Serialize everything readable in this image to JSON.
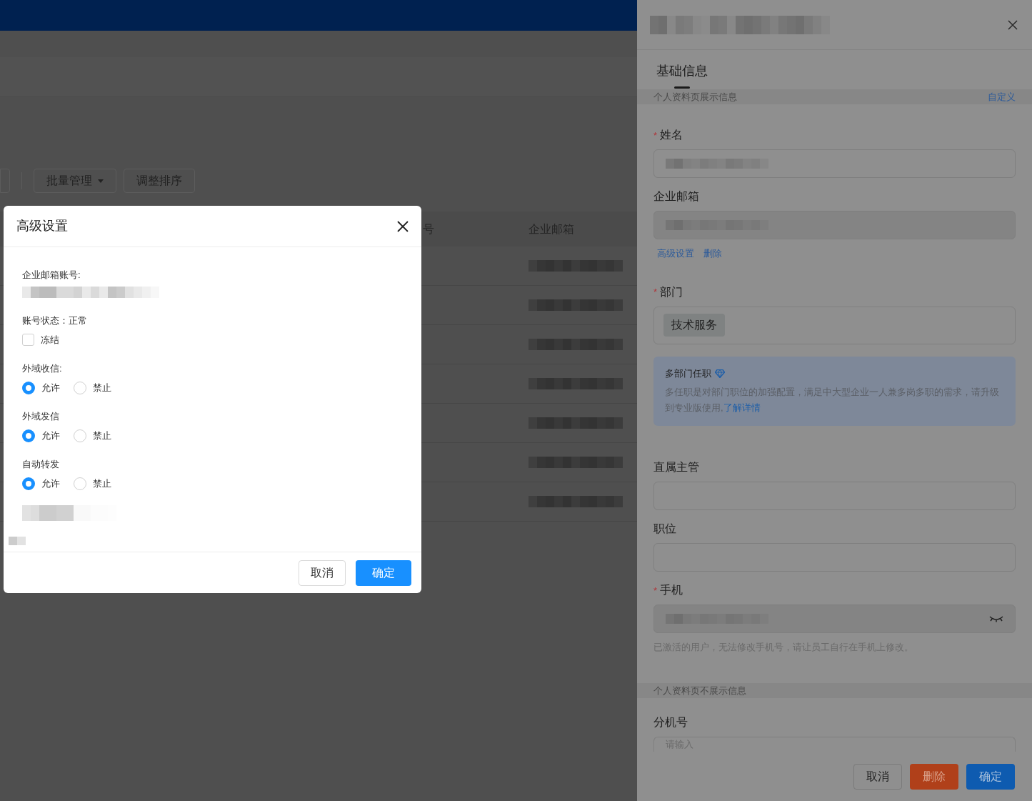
{
  "toolbar": {
    "buttons": [
      {
        "label": "批量管理",
        "dropdown": true
      },
      {
        "label": "调整排序",
        "dropdown": false
      }
    ]
  },
  "table": {
    "columns": [
      "号",
      "企业邮箱"
    ]
  },
  "dialog": {
    "title": "高级设置",
    "account_label": "企业邮箱账号:",
    "status": "账号状态：正常",
    "freeze": {
      "label": "冻结",
      "checked": false
    },
    "radio_groups": [
      {
        "label": "外域收信:",
        "options": [
          {
            "label": "允许",
            "selected": true
          },
          {
            "label": "禁止",
            "selected": false
          }
        ]
      },
      {
        "label": "外域发信",
        "options": [
          {
            "label": "允许",
            "selected": true
          },
          {
            "label": "禁止",
            "selected": false
          }
        ]
      },
      {
        "label": "自动转发",
        "options": [
          {
            "label": "允许",
            "selected": true
          },
          {
            "label": "禁止",
            "selected": false
          }
        ]
      }
    ],
    "buttons": [
      {
        "label": "取消",
        "kind": "default"
      },
      {
        "label": "确定",
        "kind": "primary"
      }
    ]
  },
  "drawer": {
    "tabs": [
      {
        "label": "基础信息",
        "selected": true
      }
    ],
    "sections": [
      {
        "kind": "header",
        "title": "个人资料页展示信息",
        "link": "自定义"
      },
      {
        "kind": "field",
        "label": "姓名",
        "marker": "*",
        "value_blurred": true
      },
      {
        "kind": "field",
        "label": "企业邮箱",
        "readonly": true,
        "value_blurred": true,
        "links": [
          "高级设置",
          "删除"
        ]
      },
      {
        "kind": "tags",
        "label": "部门",
        "marker": "*",
        "tags": [
          "技术服务"
        ]
      },
      {
        "kind": "notice",
        "title": "多部门任职",
        "text": "多任职是对部门职位的加强配置，满足中大型企业一人兼多岗多职的需求，请升级到专业版使用,",
        "link": "了解详情"
      },
      {
        "kind": "field",
        "label": "直属主管"
      },
      {
        "kind": "field",
        "label": "职位"
      },
      {
        "kind": "field",
        "label": "手机",
        "marker": "*",
        "readonly": true,
        "value_blurred": true,
        "eye": true,
        "hint": "已激活的用户，无法修改手机号，请让员工自行在手机上修改。"
      },
      {
        "kind": "header",
        "title": "个人资料页不展示信息"
      },
      {
        "kind": "field",
        "label": "分机号",
        "placeholder": "请输入"
      }
    ],
    "buttons": [
      {
        "label": "取消",
        "kind": "default"
      },
      {
        "label": "删除",
        "kind": "danger"
      },
      {
        "label": "确定",
        "kind": "primary"
      }
    ]
  }
}
